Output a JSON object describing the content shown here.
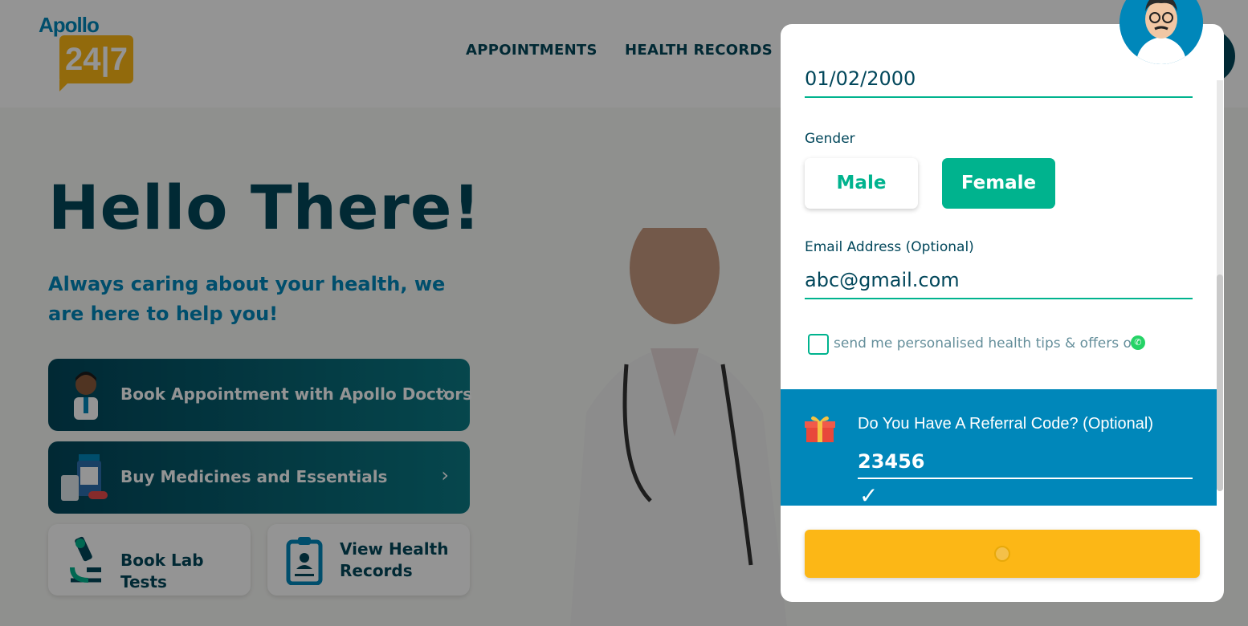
{
  "header": {
    "logo_text": "Apollo",
    "logo_number": "24|7",
    "nav": [
      "APPOINTMENTS",
      "HEALTH RECORDS"
    ]
  },
  "hero": {
    "title": "Hello There!",
    "subtitle": "Always caring about your health, we are here to help you!"
  },
  "cards": {
    "appointment": "Book Appointment with Apollo Doctors",
    "medicines": "Buy Medicines and Essentials",
    "lab": "Book Lab Tests",
    "records": "View Health Records",
    "chevron": "›"
  },
  "form": {
    "dob_value": "01/02/2000",
    "gender_label": "Gender",
    "gender_options": [
      "Male",
      "Female"
    ],
    "gender_selected": "Female",
    "email_label": "Email Address (Optional)",
    "email_value": "abc@gmail.com",
    "whatsapp_text": "send me personalised health tips & offers on",
    "whatsapp_checked": false,
    "referral_title": "Do You Have A Referral Code? (Optional)",
    "referral_value": "23456",
    "referral_valid_icon": "✓"
  },
  "icons": {
    "whatsapp": "whatsapp-icon",
    "gift": "gift-icon",
    "check": "check-icon",
    "spinner": "loading-spinner-icon"
  },
  "colors": {
    "brand_dark": "#02475b",
    "brand_green": "#00b38e",
    "brand_blue": "#0087ba",
    "brand_yellow": "#fcb716"
  }
}
